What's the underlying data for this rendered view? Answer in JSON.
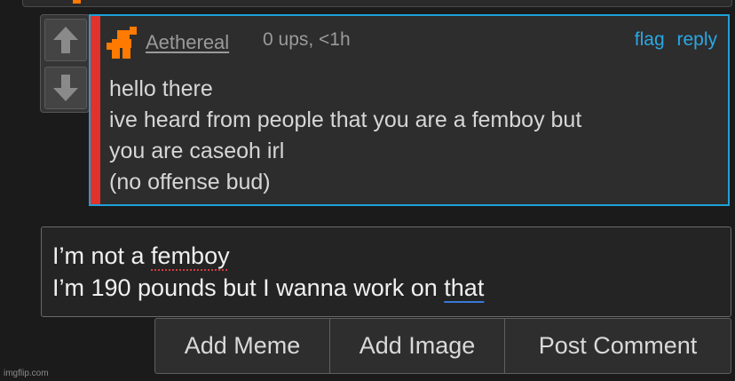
{
  "vote": {
    "up_icon": "arrow-up-icon",
    "down_icon": "arrow-down-icon"
  },
  "comment": {
    "username": "Aethereal",
    "meta": "0 ups, <1h",
    "flag": "flag",
    "reply": "reply",
    "lines": [
      "hello there",
      "ive heard from people that you are a femboy but",
      "you are caseoh irl",
      "(no offense bud)"
    ],
    "colors": {
      "border": "#1da1d8",
      "side_bar": "#e2322c",
      "accent": "#ff7a00"
    }
  },
  "reply_box": {
    "line1_before": "I’m not a ",
    "line1_misspelled": "femboy",
    "line2_before": "I’m 190 pounds but I wanna work on ",
    "line2_flagged": "that"
  },
  "buttons": {
    "meme": "Add Meme",
    "image": "Add Image",
    "post": "Post Comment"
  },
  "watermark": "imgflip.com"
}
